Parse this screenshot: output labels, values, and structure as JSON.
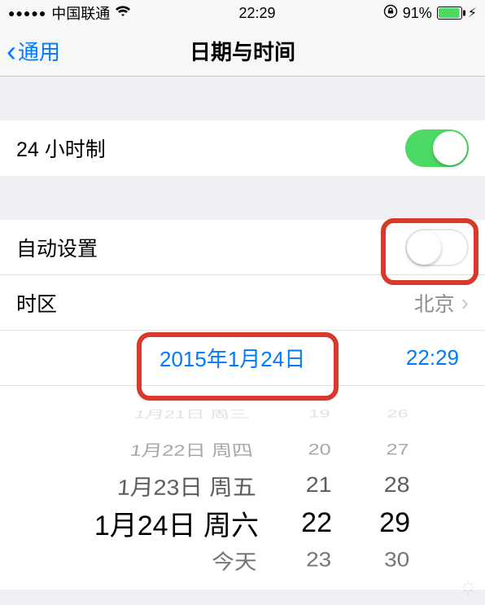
{
  "status": {
    "signal_dots": "●●●●●",
    "carrier": "中国联通",
    "time": "22:29",
    "battery_pct": "91%"
  },
  "nav": {
    "back_label": "通用",
    "title": "日期与时间"
  },
  "rows": {
    "time_format_24h": {
      "label": "24 小时制",
      "on": true
    },
    "auto_set": {
      "label": "自动设置",
      "on": false
    },
    "timezone": {
      "label": "时区",
      "value": "北京"
    }
  },
  "selected": {
    "date": "2015年1月24日",
    "time": "22:29"
  },
  "picker": {
    "date_rows": [
      "1月21日 周三",
      "1月22日 周四",
      "1月23日 周五",
      "1月24日 周六",
      "今天"
    ],
    "hour_rows": [
      "19",
      "20",
      "21",
      "22",
      "23"
    ],
    "minute_rows": [
      "26",
      "27",
      "28",
      "29",
      "30"
    ]
  }
}
